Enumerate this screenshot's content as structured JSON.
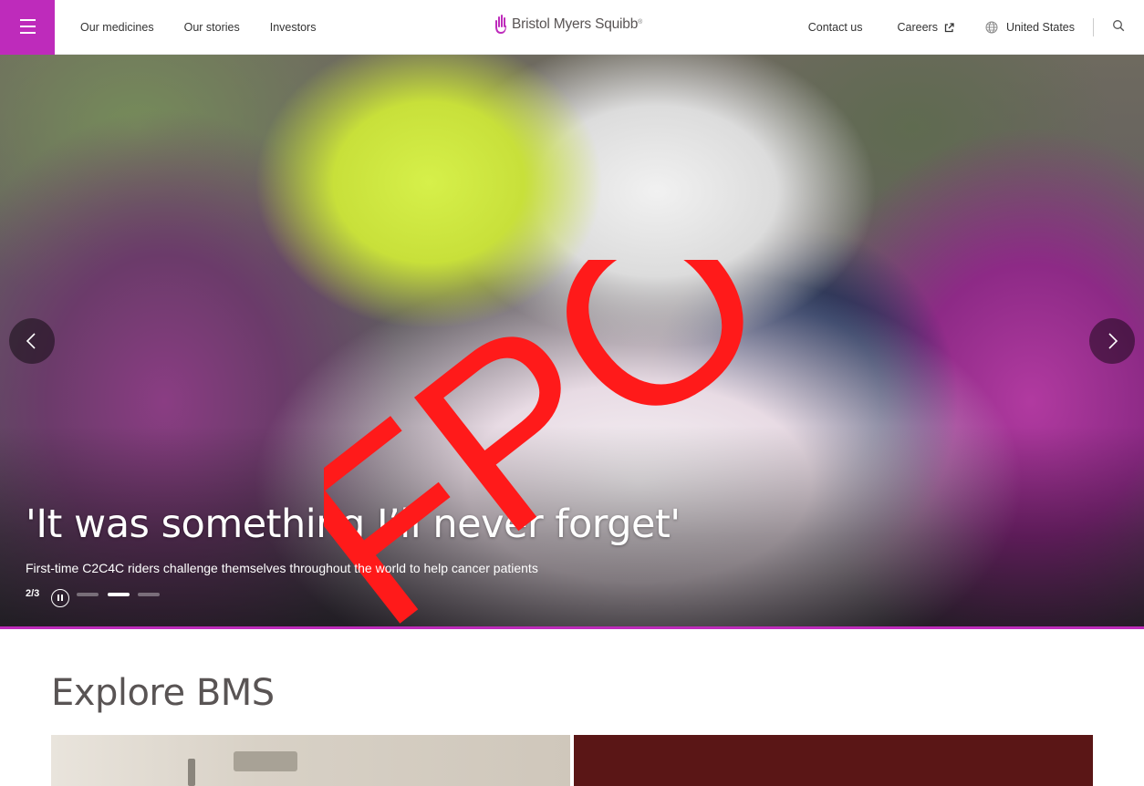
{
  "header": {
    "nav_left": [
      "Our medicines",
      "Our stories",
      "Investors"
    ],
    "logo_text": "Bristol Myers Squibb",
    "logo_reg": "®",
    "contact": "Contact us",
    "careers": "Careers",
    "country": "United States",
    "accent_color": "#be2bbb"
  },
  "hero": {
    "headline": "'It was something I’ll never forget'",
    "subline": "First-time C2C4C riders challenge themselves throughout the world to help cancer patients",
    "counter": "2/3",
    "overlay_text": "FPO",
    "active_slide": 2,
    "total_slides": 3
  },
  "explore": {
    "title": "Explore BMS"
  }
}
